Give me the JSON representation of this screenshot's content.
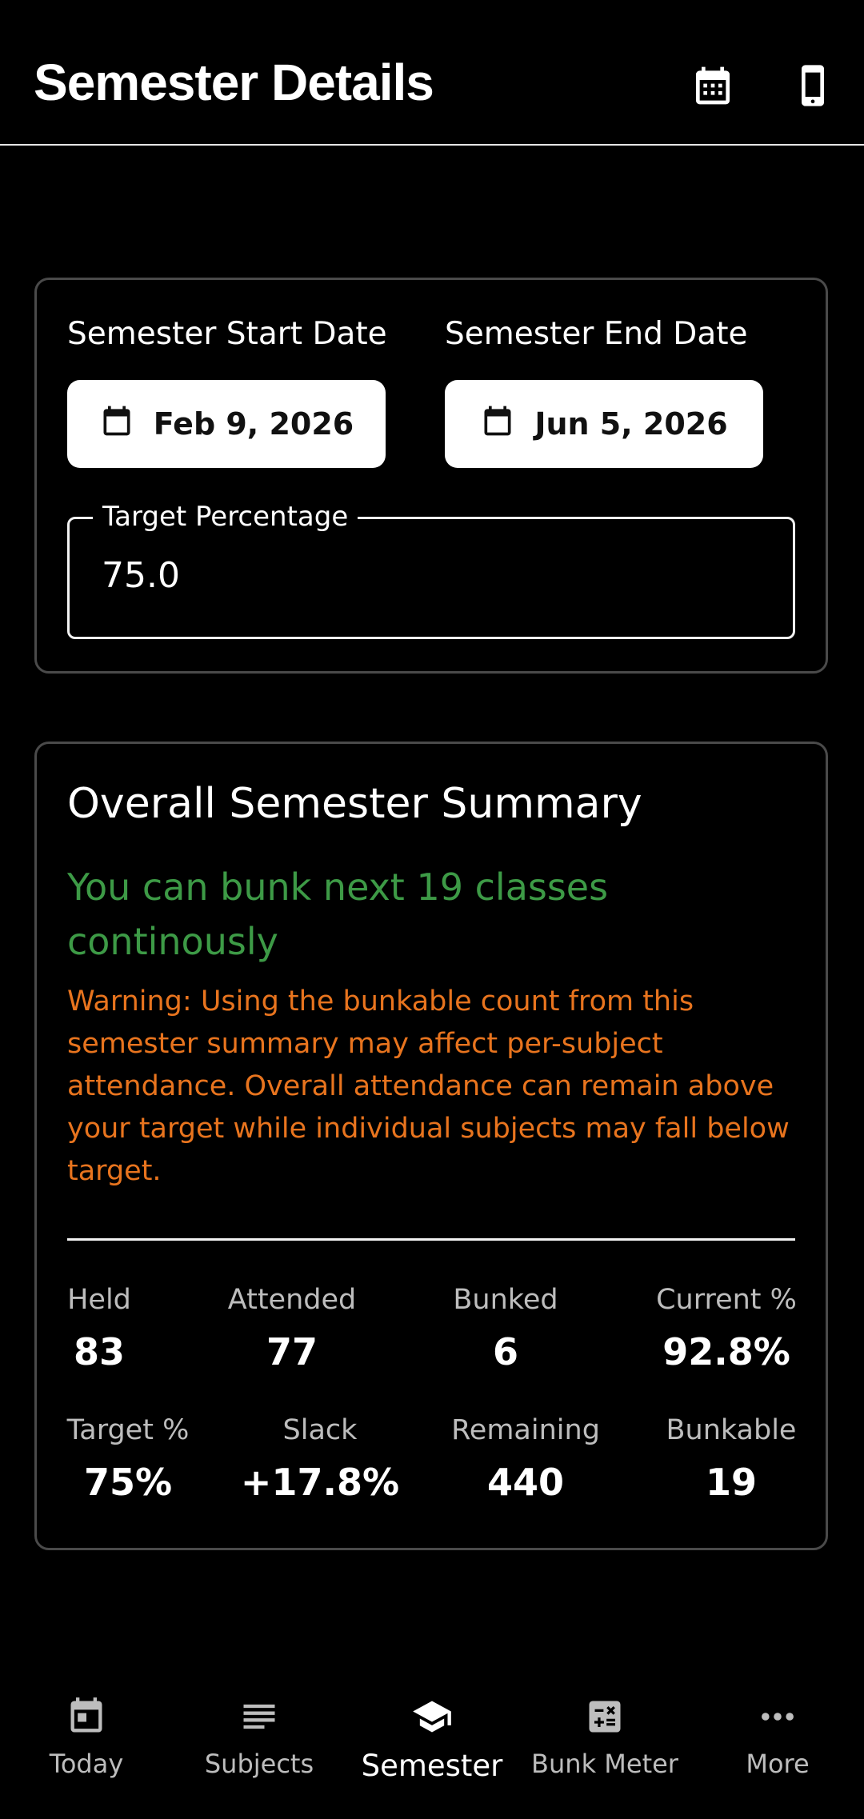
{
  "header": {
    "title": "Semester Details",
    "calendar_icon": "calendar-icon",
    "phone_icon": "phone-icon"
  },
  "settings": {
    "start_label": "Semester Start Date",
    "end_label": "Semester End Date",
    "start_date": "Feb 9, 2026",
    "end_date": "Jun 5, 2026",
    "target_label": "Target Percentage",
    "target_value": "75.0"
  },
  "summary": {
    "title": "Overall Semester Summary",
    "bunk_message": "You can bunk next 19 classes continously",
    "warning": "Warning: Using the bunkable count from this semester summary may affect per-subject attendance. Overall attendance can remain above your target while individual subjects may fall below target.",
    "stats": [
      {
        "label": "Held",
        "value": "83"
      },
      {
        "label": "Attended",
        "value": "77"
      },
      {
        "label": "Bunked",
        "value": "6"
      },
      {
        "label": "Current %",
        "value": "92.8%"
      },
      {
        "label": "Target %",
        "value": "75%"
      },
      {
        "label": "Slack",
        "value": "+17.8%"
      },
      {
        "label": "Remaining",
        "value": "440"
      },
      {
        "label": "Bunkable",
        "value": "19"
      }
    ]
  },
  "nav": {
    "items": [
      {
        "label": "Today",
        "icon": "today-icon"
      },
      {
        "label": "Subjects",
        "icon": "subjects-icon"
      },
      {
        "label": "Semester",
        "icon": "graduation-cap-icon",
        "active": true
      },
      {
        "label": "Bunk Meter",
        "icon": "calculator-icon"
      },
      {
        "label": "More",
        "icon": "more-icon"
      }
    ]
  },
  "colors": {
    "accent_green": "#3d9a46",
    "warning_orange": "#e8741e",
    "background": "#000000"
  }
}
